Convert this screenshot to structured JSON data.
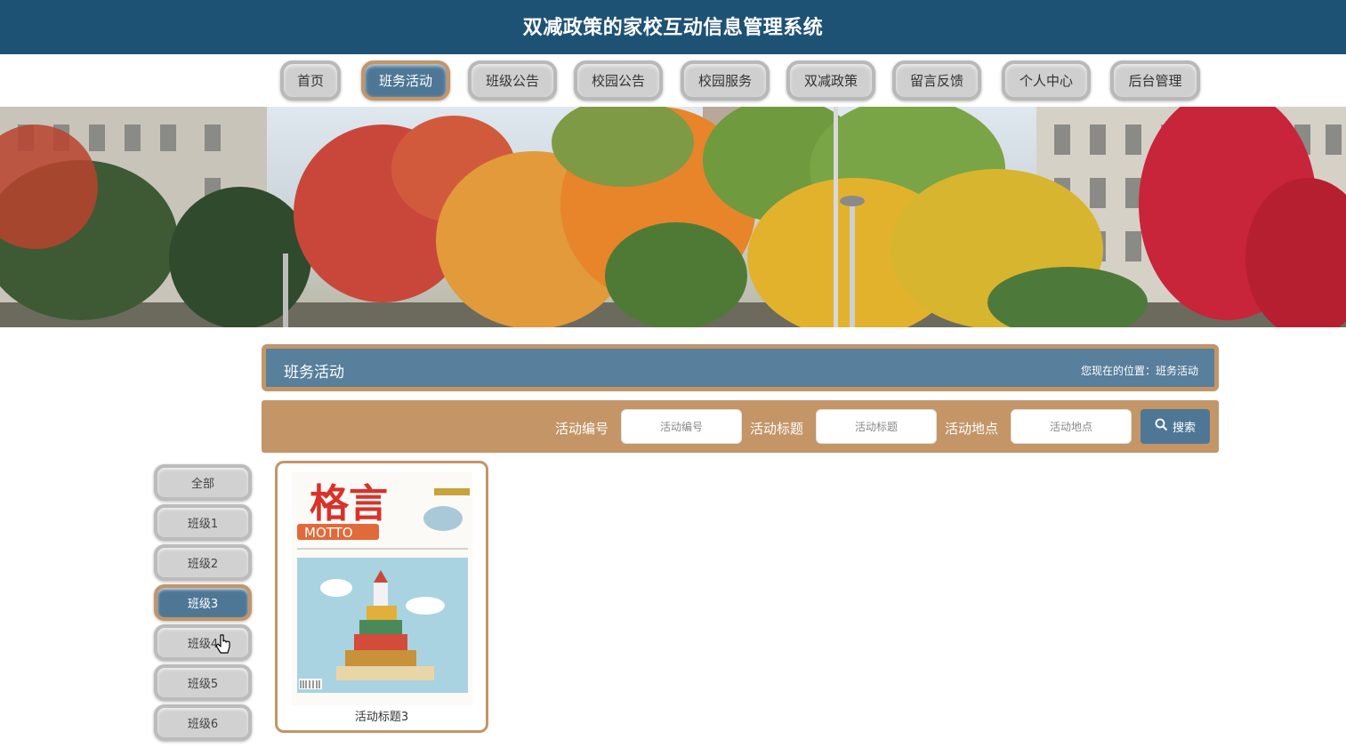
{
  "header": {
    "title": "双减政策的家校互动信息管理系统",
    "bg_color": "#1e5275"
  },
  "nav": {
    "items": [
      {
        "label": "首页",
        "active": false
      },
      {
        "label": "班务活动",
        "active": true
      },
      {
        "label": "班级公告",
        "active": false
      },
      {
        "label": "校园公告",
        "active": false
      },
      {
        "label": "校园服务",
        "active": false
      },
      {
        "label": "双减政策",
        "active": false
      },
      {
        "label": "留言反馈",
        "active": false
      },
      {
        "label": "个人中心",
        "active": false
      },
      {
        "label": "后台管理",
        "active": false
      }
    ]
  },
  "section": {
    "title": "班务活动",
    "breadcrumb": "您现在的位置：班务活动"
  },
  "search": {
    "fields": [
      {
        "label": "活动编号",
        "placeholder": "活动编号"
      },
      {
        "label": "活动标题",
        "placeholder": "活动标题"
      },
      {
        "label": "活动地点",
        "placeholder": "活动地点"
      }
    ],
    "button_label": "搜索"
  },
  "sidebar": {
    "items": [
      {
        "label": "全部",
        "active": false
      },
      {
        "label": "班级1",
        "active": false
      },
      {
        "label": "班级2",
        "active": false
      },
      {
        "label": "班级3",
        "active": true
      },
      {
        "label": "班级4",
        "active": false
      },
      {
        "label": "班级5",
        "active": false
      },
      {
        "label": "班级6",
        "active": false
      }
    ]
  },
  "cards": [
    {
      "title": "活动标题3",
      "cover": {
        "headline": "格言",
        "subtitle": "MOTTO"
      }
    }
  ],
  "colors": {
    "accent_tan": "#c39567",
    "accent_blue": "#4e7796",
    "nav_inactive": "#cfcfcf"
  }
}
